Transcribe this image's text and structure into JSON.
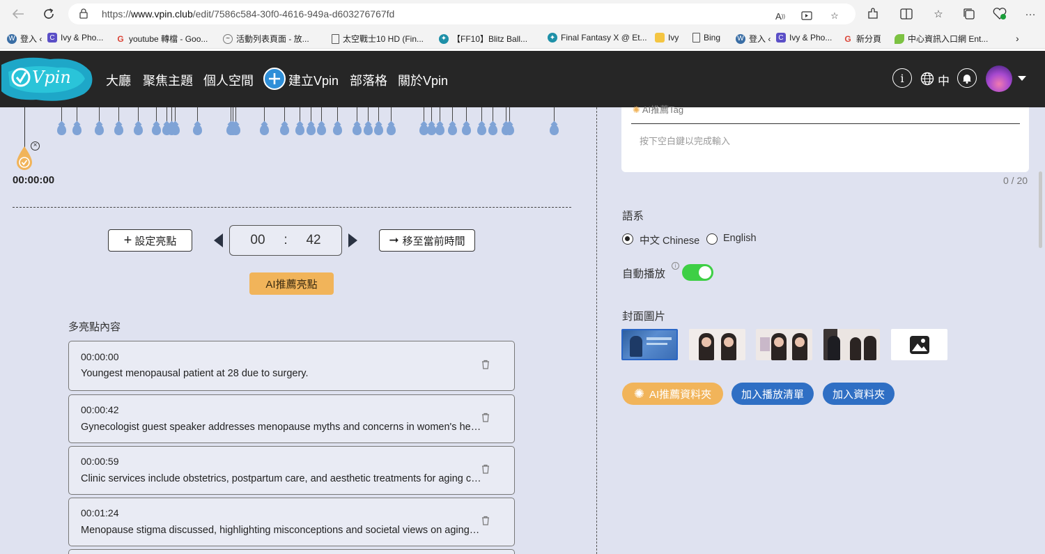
{
  "browser": {
    "url_prefix": "https://",
    "url_host": "www.vpin.club",
    "url_path": "/edit/7586c584-30f0-4616-949a-d603276767fd"
  },
  "bookmarks": [
    {
      "label": "登入 ‹",
      "icon": "wordpress-icon"
    },
    {
      "label": "Ivy & Pho...",
      "icon": "site-icon"
    },
    {
      "label": "youtube 轉檔 - Goo...",
      "icon": "google-icon"
    },
    {
      "label": "活動列表頁面 - 放...",
      "icon": "site-icon"
    },
    {
      "label": "太空戰士10 HD (Fin...",
      "icon": "page-icon"
    },
    {
      "label": "【FF10】Blitz Ball...",
      "icon": "site-icon"
    },
    {
      "label": "Final Fantasy X @ Et...",
      "icon": "site-icon"
    },
    {
      "label": "Ivy",
      "icon": "folder-icon"
    },
    {
      "label": "Bing",
      "icon": "page-icon"
    },
    {
      "label": "登入 ‹",
      "icon": "wordpress-icon"
    },
    {
      "label": "Ivy & Pho...",
      "icon": "site-icon"
    },
    {
      "label": "新分頁",
      "icon": "google-icon"
    },
    {
      "label": "中心資訊入口網 Ent...",
      "icon": "leaf-icon"
    }
  ],
  "nav": {
    "items": [
      "大廳",
      "聚焦主題",
      "個人空間",
      "建立Vpin",
      "部落格",
      "關於Vpin"
    ],
    "lang": "中"
  },
  "timeline": {
    "current_time": "00:00:00"
  },
  "controls": {
    "set_highlight": "設定亮點",
    "minutes": "00",
    "colon": ":",
    "seconds": "42",
    "move_to_current": "移至當前時間",
    "ai_recommend": "AI推薦亮點"
  },
  "highlights": {
    "title": "多亮點內容",
    "items": [
      {
        "time": "00:00:00",
        "text": "Youngest menopausal patient at 28 due to surgery."
      },
      {
        "time": "00:00:42",
        "text": "Gynecologist guest speaker addresses menopause myths and concerns in women's health."
      },
      {
        "time": "00:00:59",
        "text": "Clinic services include obstetrics, postpartum care, and aesthetic treatments for aging conc..."
      },
      {
        "time": "00:01:24",
        "text": "Menopause stigma discussed, highlighting misconceptions and societal views on aging wo..."
      }
    ]
  },
  "tags": {
    "peek_label": "AI推薦Tag",
    "placeholder": "按下空白鍵以完成輸入",
    "counter": "0 / 20"
  },
  "settings": {
    "language_label": "語系",
    "lang_options": [
      "中文 Chinese",
      "English"
    ],
    "selected_lang": "中文 Chinese",
    "autoplay_label": "自動播放",
    "autoplay_on": true,
    "cover_label": "封面圖片"
  },
  "actions": {
    "ai_folder": "AI推薦資料夾",
    "add_playlist": "加入播放清單",
    "add_folder": "加入資料夾"
  },
  "colors": {
    "header_bg": "#262626",
    "accent_orange": "#f1b45a",
    "accent_blue": "#2f6fc4",
    "page_bg": "#dfe2f0",
    "toggle_on": "#3ecf45",
    "drop_blue": "#7fa3d6"
  }
}
